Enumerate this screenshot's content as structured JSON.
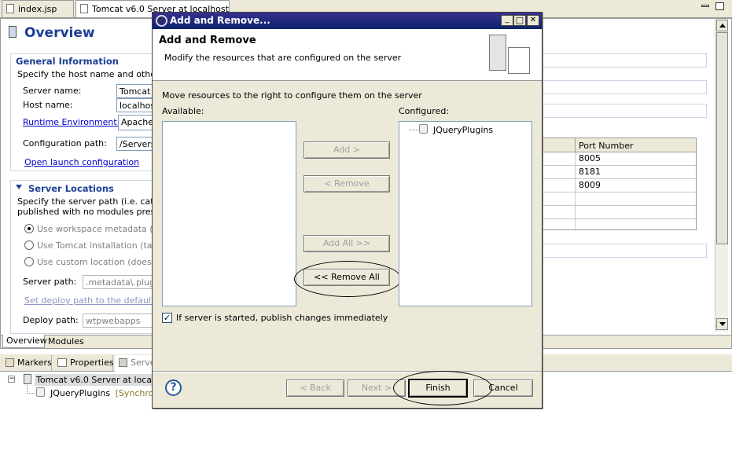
{
  "editor_tabs": [
    {
      "label": "index.jsp"
    },
    {
      "label": "Tomcat v6.0 Server at localhost"
    }
  ],
  "editor_close": "✕",
  "overview": {
    "title": "Overview",
    "general": {
      "title": "General Information",
      "desc": "Specify the host name and other co",
      "server_name_label": "Server name:",
      "server_name_value": "Tomcat v",
      "host_name_label": "Host name:",
      "host_name_value": "localhost",
      "runtime_label": "Runtime Environment:",
      "runtime_value": "Apache T",
      "config_path_label": "Configuration path:",
      "config_path_value": "/Servers",
      "open_launch": "Open launch configuration"
    },
    "locations": {
      "title": "Server Locations",
      "desc1": "Specify the server path (i.e. catalin",
      "desc2": "published with no modules present t",
      "radio1": "Use workspace metadata (doe",
      "radio2": "Use Tomcat installation (takes",
      "radio3": "Use custom location (does not",
      "server_path_label": "Server path:",
      "server_path_value": ".metadata\\.plugin",
      "set_deploy": "Set deploy path to the default val",
      "deploy_path_label": "Deploy path:",
      "deploy_path_value": "wtpwebapps"
    },
    "ports": {
      "header": "Port Number",
      "values": [
        "8005",
        "8181",
        "8009"
      ]
    },
    "bottom_tabs": [
      "Overview",
      "Modules"
    ]
  },
  "views": {
    "tabs": [
      "Markers",
      "Properties",
      "Serve"
    ],
    "tree": {
      "toggle": "−",
      "server": "Tomcat v6.0 Server at localhos",
      "module": "JQueryPlugins",
      "module_status": "[Synchroniz"
    }
  },
  "dialog": {
    "window_title": "Add and Remove...",
    "window_buttons": {
      "minimize": "_",
      "maximize": "□",
      "close": "✕"
    },
    "header_title": "Add and Remove",
    "header_desc": "Modify the resources that are configured on the server",
    "instruction": "Move resources to the right to configure them on the server",
    "available_label": "Available:",
    "configured_label": "Configured:",
    "configured_items": [
      {
        "label": "JQueryPlugins"
      }
    ],
    "buttons": {
      "add": "Add >",
      "remove": "< Remove",
      "add_all": "Add All >>",
      "remove_all": "<< Remove All"
    },
    "publish_checkbox": "If server is started, publish changes immediately",
    "publish_checked": true,
    "help_glyph": "?",
    "footer_buttons": {
      "back": "< Back",
      "next": "Next >",
      "finish": "Finish",
      "cancel": "Cancel"
    }
  }
}
